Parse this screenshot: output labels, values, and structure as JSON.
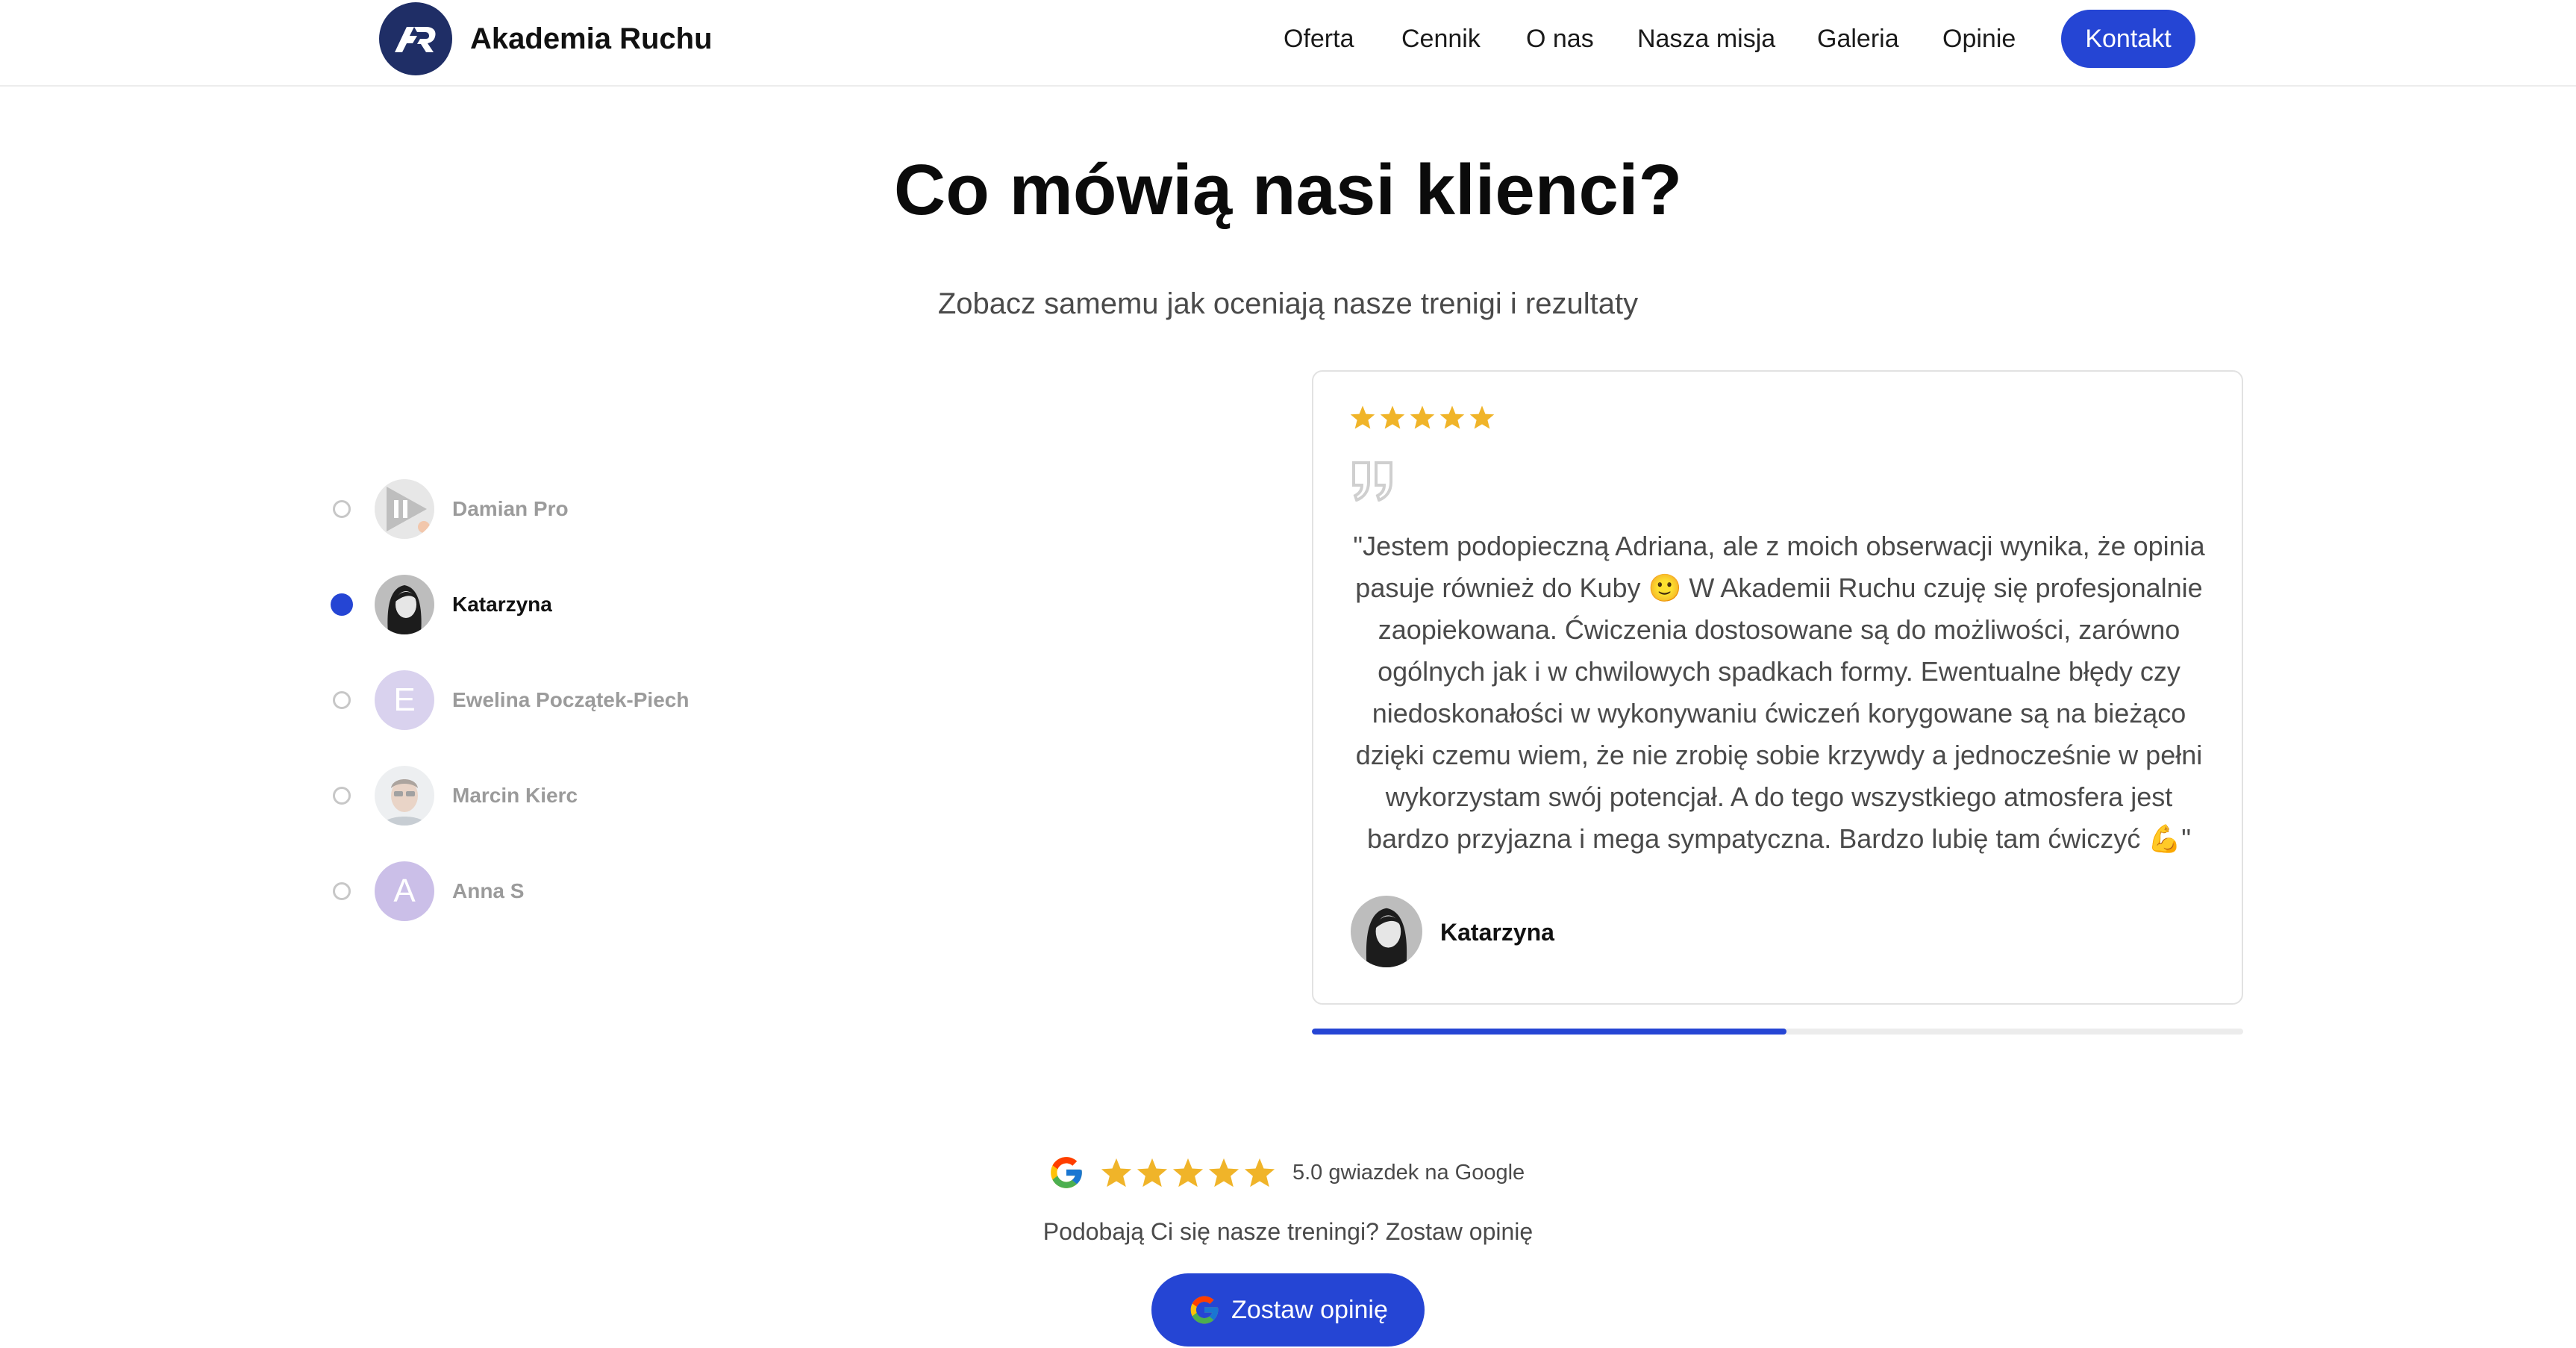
{
  "header": {
    "brand": "Akademia Ruchu",
    "nav": [
      "Oferta",
      "Cennik",
      "O nas",
      "Nasza misja",
      "Galeria",
      "Opinie"
    ],
    "cta": "Kontakt"
  },
  "section": {
    "title": "Co mówią nasi klienci?",
    "subtitle": "Zobacz samemu jak oceniają nasze trenigi i rezultaty"
  },
  "reviewers": [
    {
      "name": "Damian Pro",
      "avatar": "video-thumbnail",
      "active": false
    },
    {
      "name": "Katarzyna",
      "avatar": "photo",
      "active": true
    },
    {
      "name": "Ewelina Początek-Piech",
      "avatar_letter": "E",
      "active": false
    },
    {
      "name": "Marcin Kierc",
      "avatar": "photo",
      "active": false
    },
    {
      "name": "Anna S",
      "avatar_letter": "A",
      "active": false
    }
  ],
  "review": {
    "rating": 5,
    "text": "\"Jestem podopieczną Adriana, ale z moich obserwacji wynika, że opinia pasuje również do Kuby 🙂 W Akademii Ruchu czuję się profesjonalnie zaopiekowana. Ćwiczenia dostosowane są do możliwości, zarówno ogólnych jak i w chwilowych spadkach formy. Ewentualne błędy czy niedoskonałości w wykonywaniu ćwiczeń korygowane są na bieżąco dzięki czemu wiem, że nie zrobię sobie krzywdy a jednocześnie w pełni wykorzystam swój potencjał. A do tego wszystkiego atmosfera jest bardzo przyjazna i mega sympatyczna. Bardzo lubię tam ćwiczyć 💪\"",
    "author": "Katarzyna"
  },
  "slider_progress": 0.51,
  "google": {
    "rating_text": "5.0 gwiazdek na Google",
    "stars": 5,
    "prompt": "Podobają Ci się nasze treningi? Zostaw opinię",
    "button": "Zostaw opinię"
  },
  "colors": {
    "accent": "#2545d4",
    "star": "#f0b429",
    "logo_bg": "#1f2e66"
  },
  "icons": [
    "logo-icon",
    "star-icon",
    "quote-icon",
    "google-icon",
    "play-icon"
  ]
}
